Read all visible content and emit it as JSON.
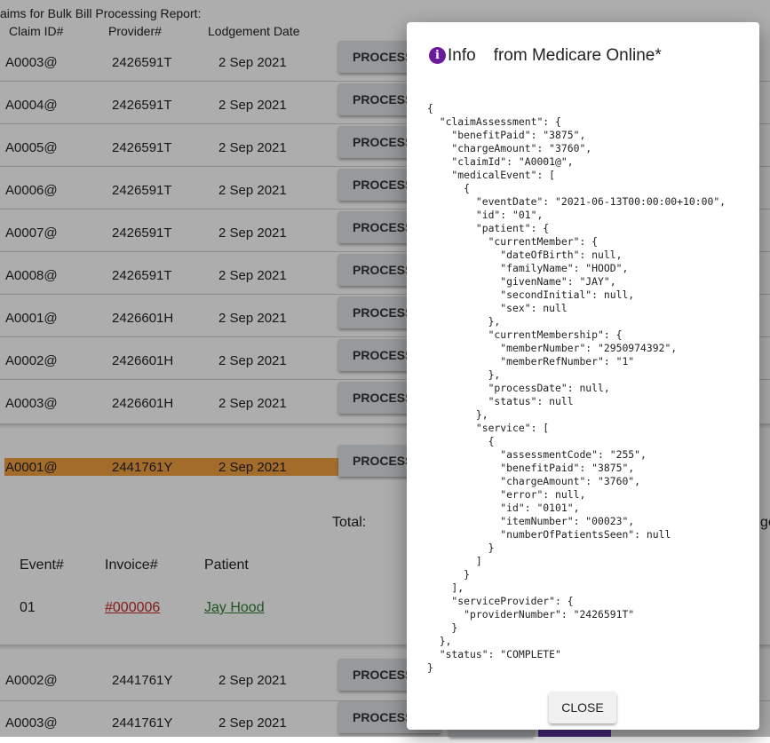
{
  "report": {
    "title": "aims for Bulk Bill Processing Report:",
    "columns": {
      "claim_id": "Claim ID#",
      "provider": "Provider#",
      "lodgement": "Lodgement Date"
    },
    "rows_top": [
      {
        "claim": "A0003@",
        "provider": "2426591T",
        "date": "2 Sep 2021",
        "action": "PROCESS"
      },
      {
        "claim": "A0004@",
        "provider": "2426591T",
        "date": "2 Sep 2021",
        "action": "PROCESS"
      },
      {
        "claim": "A0005@",
        "provider": "2426591T",
        "date": "2 Sep 2021",
        "action": "PROCESS"
      },
      {
        "claim": "A0006@",
        "provider": "2426591T",
        "date": "2 Sep 2021",
        "action": "PROCESS"
      },
      {
        "claim": "A0007@",
        "provider": "2426591T",
        "date": "2 Sep 2021",
        "action": "PROCESS"
      },
      {
        "claim": "A0008@",
        "provider": "2426591T",
        "date": "2 Sep 2021",
        "action": "PROCESS"
      },
      {
        "claim": "A0001@",
        "provider": "2426601H",
        "date": "2 Sep 2021",
        "action": "PROCESS"
      },
      {
        "claim": "A0002@",
        "provider": "2426601H",
        "date": "2 Sep 2021",
        "action": "PROCESS"
      },
      {
        "claim": "A0003@",
        "provider": "2426601H",
        "date": "2 Sep 2021",
        "action": "PROCESS"
      }
    ],
    "highlighted_row": {
      "claim": "A0001@",
      "provider": "2441761Y",
      "date": "2 Sep 2021",
      "action": "PROCESS"
    },
    "total_label": "Total:",
    "edge_text": "ge",
    "detail": {
      "headers": {
        "event": "Event#",
        "invoice": "Invoice#",
        "patient": "Patient"
      },
      "row": {
        "event": "01",
        "invoice": "#000006",
        "patient": "Jay Hood"
      }
    },
    "rows_bottom": [
      {
        "claim": "A0002@",
        "provider": "2441761Y",
        "date": "2 Sep 2021",
        "action": "PROCESS"
      },
      {
        "claim": "A0003@",
        "provider": "2441761Y",
        "date": "2 Sep 2021",
        "action": "PROCESS"
      }
    ]
  },
  "dialog": {
    "icon": "info-icon",
    "title_info": "Info",
    "title_source": "from Medicare Online*",
    "json_text": "{\n  \"claimAssessment\": {\n    \"benefitPaid\": \"3875\",\n    \"chargeAmount\": \"3760\",\n    \"claimId\": \"A0001@\",\n    \"medicalEvent\": [\n      {\n        \"eventDate\": \"2021-06-13T00:00:00+10:00\",\n        \"id\": \"01\",\n        \"patient\": {\n          \"currentMember\": {\n            \"dateOfBirth\": null,\n            \"familyName\": \"HOOD\",\n            \"givenName\": \"JAY\",\n            \"secondInitial\": null,\n            \"sex\": null\n          },\n          \"currentMembership\": {\n            \"memberNumber\": \"2950974392\",\n            \"memberRefNumber\": \"1\"\n          },\n          \"processDate\": null,\n          \"status\": null\n        },\n        \"service\": [\n          {\n            \"assessmentCode\": \"255\",\n            \"benefitPaid\": \"3875\",\n            \"chargeAmount\": \"3760\",\n            \"error\": null,\n            \"id\": \"0101\",\n            \"itemNumber\": \"00023\",\n            \"numberOfPatientsSeen\": null\n          }\n        ]\n      }\n    ],\n    \"serviceProvider\": {\n      \"providerNumber\": \"2426591T\"\n    }\n  },\n  \"status\": \"COMPLETE\"\n}",
    "close_label": "CLOSE"
  },
  "colors": {
    "highlight": "#f0a040",
    "accent": "#673ab7",
    "info_icon": "#6a1b9a",
    "invoice_link": "#c62828",
    "patient_link": "#2e7d32"
  }
}
